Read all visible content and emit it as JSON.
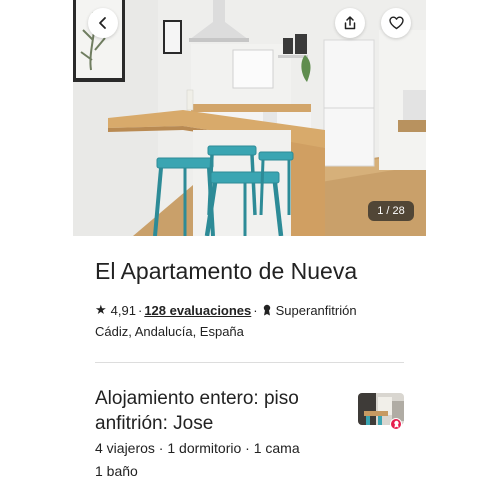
{
  "photo": {
    "counter": "1 / 28",
    "alt_icon": "apartment-kitchen-photo"
  },
  "actions": {
    "back_icon": "chevron-left-icon",
    "share_icon": "share-icon",
    "save_icon": "heart-icon"
  },
  "listing": {
    "title": "El Apartamento de Nueva",
    "rating": "4,91",
    "separator": "·",
    "reviews": "128 evaluaciones",
    "host_status": "Superanfitrión",
    "location": "Cádiz, Andalucía, España"
  },
  "summary": {
    "type": "Alojamiento entero: piso anfitrión: Jose",
    "capacity": "4 viajeros · 1 dormitorio · 1 cama",
    "bathrooms": "1 baño"
  },
  "colors": {
    "accent": "#e61e4d",
    "text": "#222222",
    "divider": "#dddddd"
  }
}
